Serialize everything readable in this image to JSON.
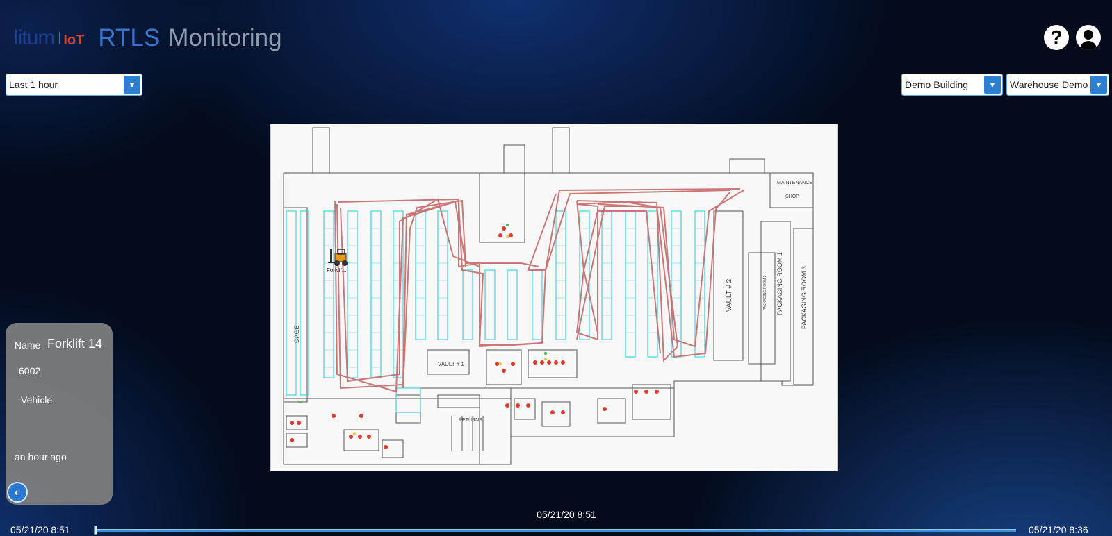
{
  "header": {
    "logo_brand": "litum",
    "logo_suffix": "IoT",
    "title_primary": "RTLS",
    "title_secondary": "Monitoring",
    "help_icon": "question-icon",
    "user_icon": "user-icon"
  },
  "filters": {
    "time_range": "Last 1 hour",
    "building": "Demo Building",
    "floor": "Warehouse Demo"
  },
  "map": {
    "labels": {
      "maintenance": "MAINTENANCE",
      "shop": "SHOP",
      "vault2": "VAULT # 2",
      "vault1": "VAULT # 1",
      "packaging1": "PACKAGING ROOM 1",
      "packaging2": "PACKAGING ROOM 2",
      "packaging3": "PACKAGING ROOM 3",
      "cage": "CAGE",
      "returns": "RETURNS"
    },
    "asset_marker": {
      "label": "Forklif...",
      "icon": "forklift-icon"
    },
    "path_color": "#c76a6a",
    "rack_color": "#3fd6e0"
  },
  "asset_panel": {
    "name_label": "Name",
    "name": "Forklift 14",
    "tag_id": "6002",
    "type": "Vehicle",
    "last_seen": "an hour ago",
    "icon": "asset-type-icon"
  },
  "timeline": {
    "start": "05/21/20 8:51",
    "current": "05/21/20 8:51",
    "end": "05/21/20 8:36",
    "position": 0
  }
}
